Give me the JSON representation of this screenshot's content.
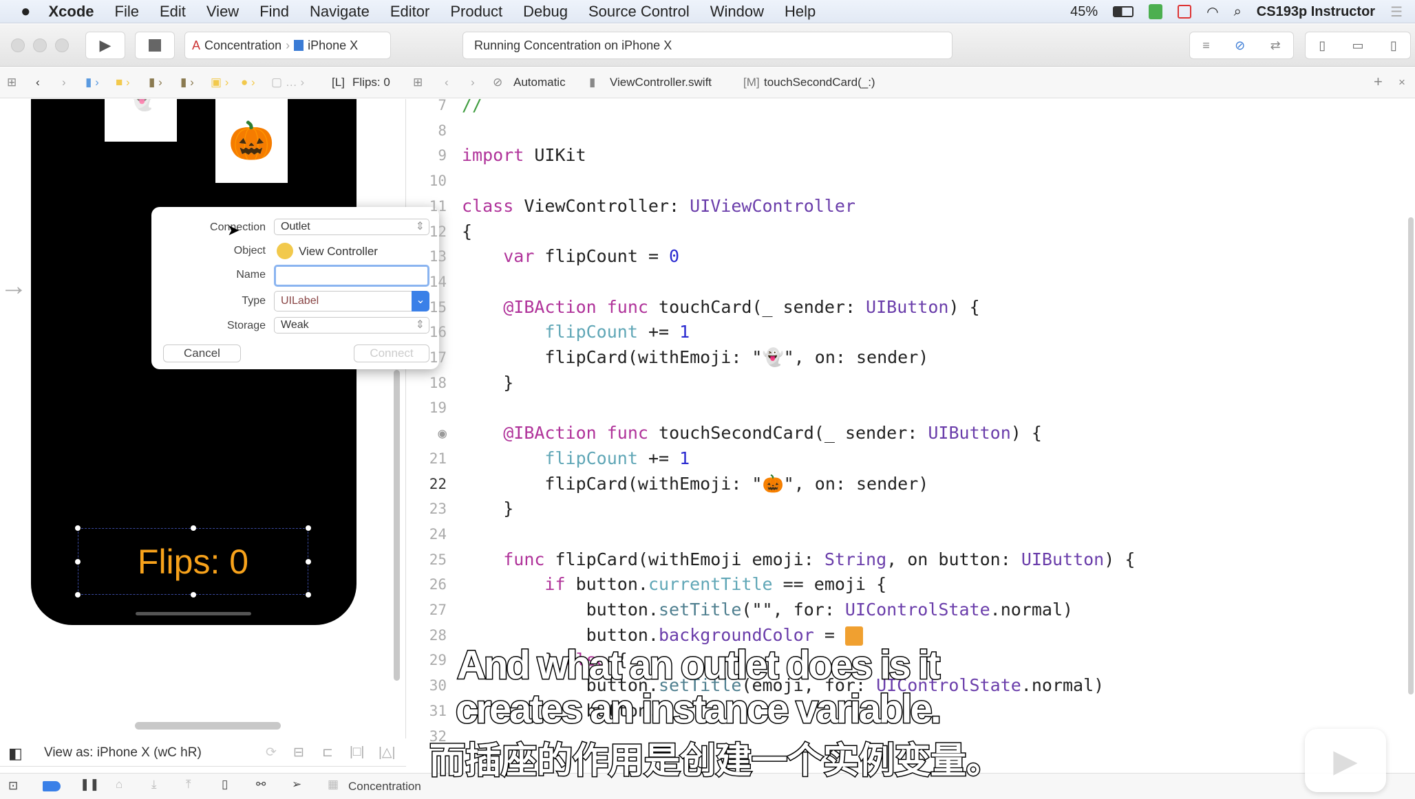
{
  "menubar": {
    "app": "Xcode",
    "items": [
      "File",
      "Edit",
      "View",
      "Find",
      "Navigate",
      "Editor",
      "Product",
      "Debug",
      "Source Control",
      "Window",
      "Help"
    ],
    "battery": "45%",
    "user": "CS193p Instructor"
  },
  "toolbar": {
    "scheme": "Concentration",
    "device": "iPhone X",
    "status": "Running Concentration on iPhone X"
  },
  "jumpbar_left": {
    "label_item": "Flips: 0"
  },
  "jumpbar_right": {
    "mode": "Automatic",
    "file": "ViewController.swift",
    "method": "touchSecondCard(_:)"
  },
  "canvas": {
    "flips_label": "Flips: 0",
    "card2_emoji": "🎃",
    "card1_emoji": "👻"
  },
  "dialog": {
    "connection_label": "Connection",
    "connection_value": "Outlet",
    "object_label": "Object",
    "object_value": "View Controller",
    "name_label": "Name",
    "name_value": "",
    "type_label": "Type",
    "type_value": "UILabel",
    "storage_label": "Storage",
    "storage_value": "Weak",
    "cancel": "Cancel",
    "connect": "Connect"
  },
  "viewas": {
    "label": "View as: iPhone X (wC hR)"
  },
  "debugbar": {
    "target": "Concentration"
  },
  "code": {
    "current_line": "22",
    "lines": [
      {
        "n": "7",
        "t": [
          [
            "//",
            "cm"
          ]
        ]
      },
      {
        "n": "8",
        "t": []
      },
      {
        "n": "9",
        "t": [
          [
            "import",
            "kw"
          ],
          [
            " UIKit",
            ""
          ]
        ]
      },
      {
        "n": "10",
        "t": []
      },
      {
        "n": "11",
        "t": [
          [
            "class",
            "kw"
          ],
          [
            " ViewController: ",
            ""
          ],
          [
            "UIViewController",
            "ty"
          ]
        ]
      },
      {
        "n": "12",
        "t": [
          [
            "{",
            ""
          ]
        ]
      },
      {
        "n": "13",
        "t": [
          [
            "    ",
            ""
          ],
          [
            "var",
            "kw"
          ],
          [
            " flipCount = ",
            ""
          ],
          [
            "0",
            "nm"
          ]
        ]
      },
      {
        "n": "14",
        "t": []
      },
      {
        "n": "15",
        "t": [
          [
            "    ",
            ""
          ],
          [
            "@IBAction",
            "kw"
          ],
          [
            " ",
            ""
          ],
          [
            "func",
            "kw"
          ],
          [
            " touchCard(_ sender: ",
            ""
          ],
          [
            "UIButton",
            "ty"
          ],
          [
            ") {",
            ""
          ]
        ]
      },
      {
        "n": "16",
        "t": [
          [
            "        ",
            ""
          ],
          [
            "flipCount",
            "pr"
          ],
          [
            " += ",
            ""
          ],
          [
            "1",
            "nm"
          ]
        ]
      },
      {
        "n": "17",
        "t": [
          [
            "        flipCard(withEmoji: \"👻\", on: sender)",
            ""
          ]
        ]
      },
      {
        "n": "18",
        "t": [
          [
            "    }",
            ""
          ]
        ]
      },
      {
        "n": "19",
        "t": []
      },
      {
        "n": "20",
        "t": [
          [
            "    ",
            ""
          ],
          [
            "@IBAction",
            "kw"
          ],
          [
            " ",
            ""
          ],
          [
            "func",
            "kw"
          ],
          [
            " touchSecondCard(_ sender: ",
            ""
          ],
          [
            "UIButton",
            "ty"
          ],
          [
            ") {",
            ""
          ]
        ]
      },
      {
        "n": "21",
        "t": [
          [
            "        ",
            ""
          ],
          [
            "flipCount",
            "pr"
          ],
          [
            " += ",
            ""
          ],
          [
            "1",
            "nm"
          ]
        ]
      },
      {
        "n": "22",
        "t": [
          [
            "        flipCard(withEmoji: \"🎃\", on: sender)",
            ""
          ]
        ]
      },
      {
        "n": "23",
        "t": [
          [
            "    }",
            ""
          ]
        ]
      },
      {
        "n": "24",
        "t": []
      },
      {
        "n": "25",
        "t": [
          [
            "    ",
            ""
          ],
          [
            "func",
            "kw"
          ],
          [
            " flipCard(withEmoji emoji: ",
            ""
          ],
          [
            "String",
            "ty"
          ],
          [
            ", on button: ",
            ""
          ],
          [
            "UIButton",
            "ty"
          ],
          [
            ") {",
            ""
          ]
        ]
      },
      {
        "n": "26",
        "t": [
          [
            "        ",
            ""
          ],
          [
            "if",
            "kw"
          ],
          [
            " button.",
            ""
          ],
          [
            "currentTitle",
            "pr"
          ],
          [
            " == emoji {",
            ""
          ]
        ]
      },
      {
        "n": "27",
        "t": [
          [
            "            button.",
            ""
          ],
          [
            "setTitle",
            "me"
          ],
          [
            "(\"\", for: ",
            ""
          ],
          [
            "UIControlState",
            "ty"
          ],
          [
            ".normal)",
            ""
          ]
        ]
      },
      {
        "n": "28",
        "t": [
          [
            "            button.",
            ""
          ],
          [
            "backgroundColor",
            "ty"
          ],
          [
            " = ",
            ""
          ],
          [
            "",
            "sw"
          ]
        ]
      },
      {
        "n": "29",
        "t": [
          [
            "        } ",
            ""
          ],
          [
            "else",
            "kw"
          ],
          [
            " {",
            ""
          ]
        ]
      },
      {
        "n": "30",
        "t": [
          [
            "            button.",
            ""
          ],
          [
            "setTitle",
            "me"
          ],
          [
            "(emoji, for: ",
            ""
          ],
          [
            "UIControlState",
            "ty"
          ],
          [
            ".normal)",
            ""
          ]
        ]
      },
      {
        "n": "31",
        "t": [
          [
            "            button.",
            ""
          ]
        ]
      },
      {
        "n": "32",
        "t": []
      }
    ]
  },
  "subtitles": {
    "en1": "And what an outlet does is it",
    "en2": "creates an instance variable.",
    "zh": "而插座的作用是创建一个实例变量。"
  },
  "colors": {
    "keyword": "#b0339a",
    "type": "#6a3daa",
    "number": "#2a2ad0",
    "flips_label": "#f7a21b"
  }
}
